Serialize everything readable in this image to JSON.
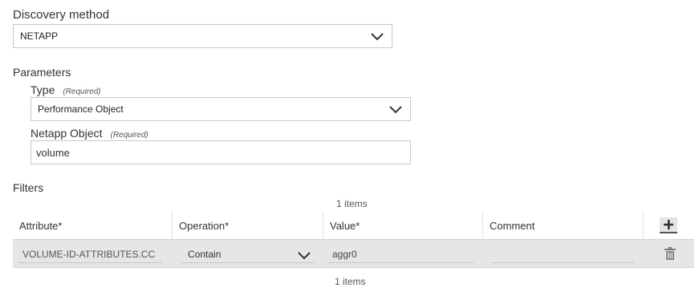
{
  "discovery": {
    "label": "Discovery method",
    "selected": "NETAPP"
  },
  "parameters": {
    "label": "Parameters",
    "type": {
      "label": "Type",
      "required": "(Required)",
      "selected": "Performance Object"
    },
    "netapp_object": {
      "label": "Netapp Object",
      "required": "(Required)",
      "value": "volume"
    }
  },
  "filters": {
    "label": "Filters",
    "count_top": "1 items",
    "count_bottom": "1 items",
    "columns": [
      "Attribute*",
      "Operation*",
      "Value*",
      "Comment"
    ],
    "rows": [
      {
        "attribute": "VOLUME-ID-ATTRIBUTES.CC",
        "operation": "Contain",
        "value": "aggr0",
        "comment": ""
      }
    ]
  },
  "icons": {
    "chevron": "chevron-down-icon",
    "add": "plus-icon",
    "delete": "trash-icon"
  }
}
